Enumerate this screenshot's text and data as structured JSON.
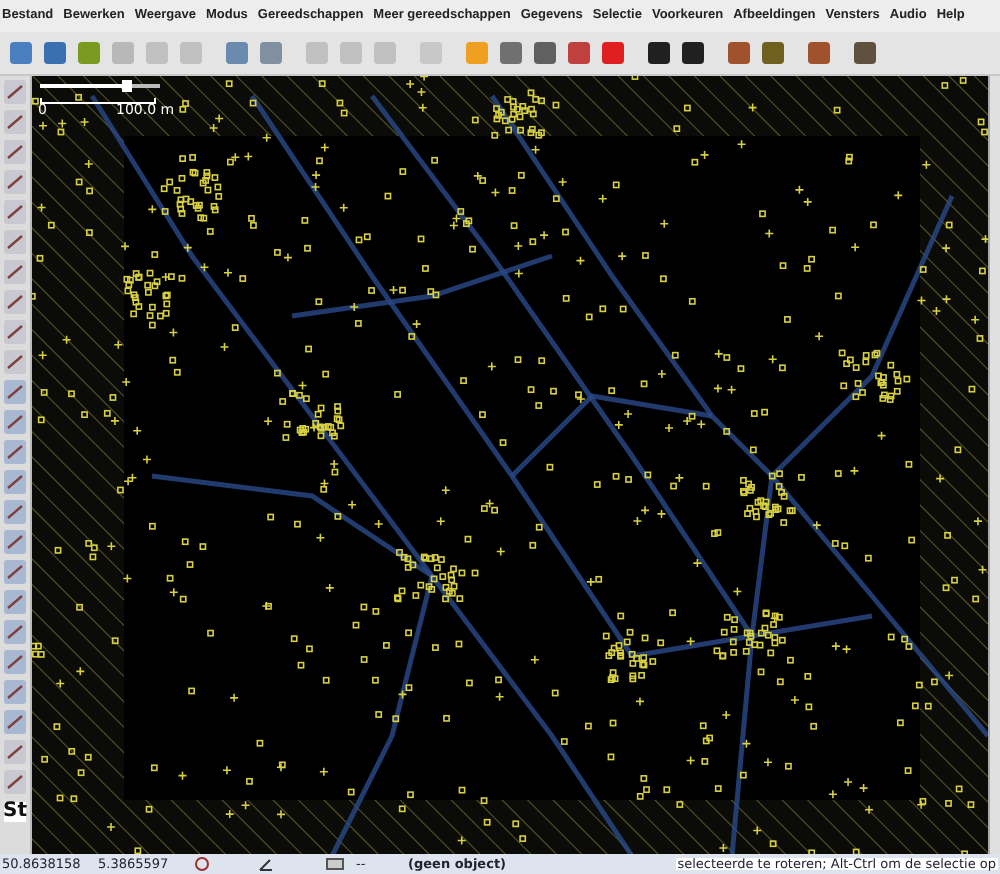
{
  "menu": [
    "Bestand",
    "Bewerken",
    "Weergave",
    "Modus",
    "Gereedschappen",
    "Meer gereedschappen",
    "Gegevens",
    "Selectie",
    "Voorkeuren",
    "Afbeeldingen",
    "Vensters",
    "Audio",
    "Help"
  ],
  "map": {
    "zoom_slider": {
      "level": 0.72
    },
    "scale_start": "0",
    "scale_label": "100.0 m",
    "style_button": "St"
  },
  "status_bar": {
    "latitude": "50.8638158",
    "longitude": "5.3865597",
    "distance": "--",
    "object": "(geen object)",
    "hint": "selecteerde te roteren; Alt-Ctrl om de selectie op"
  }
}
